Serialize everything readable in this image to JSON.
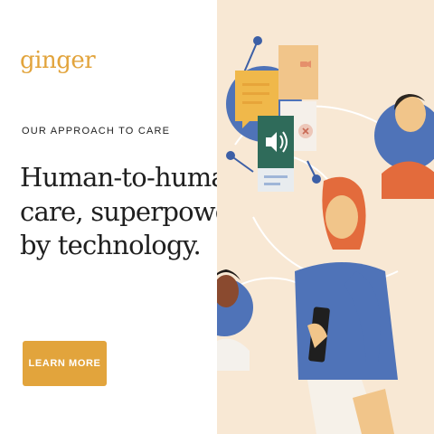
{
  "brand": {
    "name": "ginger",
    "color": "#e2a43c"
  },
  "eyebrow": "OUR APPROACH TO CARE",
  "headline": {
    "line1": "Human-to-human",
    "line2": "care, superpowered",
    "line3": "by technology."
  },
  "cta": {
    "label": "LEARN MORE",
    "color": "#e2a43c"
  },
  "illustration": {
    "background": "#f8e8d4",
    "icons": [
      "chat-bubble-icon",
      "video-camera-icon",
      "speaker-icon",
      "close-icon"
    ]
  }
}
